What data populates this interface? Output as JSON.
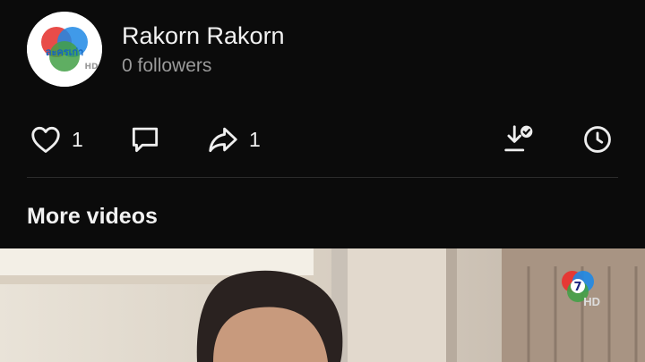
{
  "channel": {
    "name": "Rakorn Rakorn",
    "followers": "0 followers",
    "avatar_text": "ละครเก่า",
    "avatar_hd": "HD"
  },
  "actions": {
    "like_count": "1",
    "share_count": "1",
    "icons": [
      "heart-icon",
      "comment-icon",
      "share-icon",
      "download-icon",
      "history-icon"
    ]
  },
  "more_videos": {
    "title": "More videos",
    "thumb_badge": "7",
    "thumb_hd": "HD"
  },
  "colors": {
    "background": "#0b0b0b",
    "text_primary": "#f2f2f2",
    "text_secondary": "#9a9a9a",
    "divider": "#2c2c2c"
  }
}
